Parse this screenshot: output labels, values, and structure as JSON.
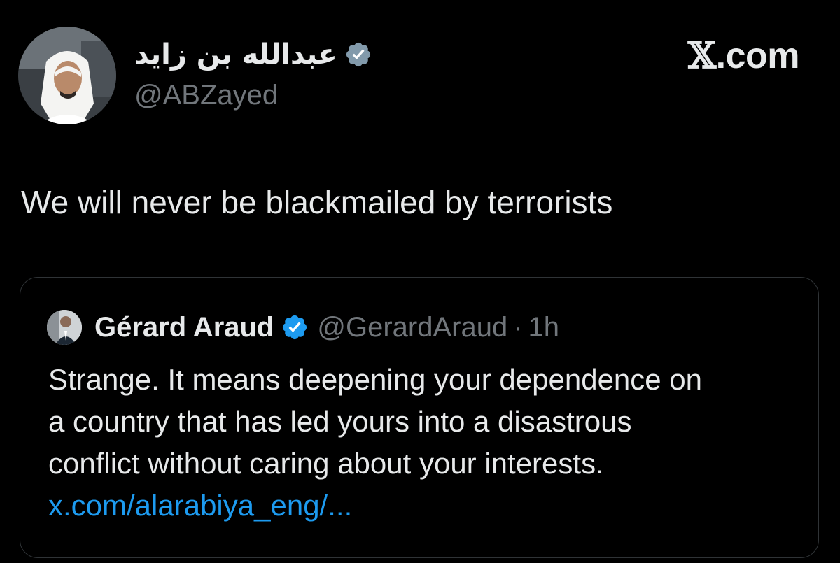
{
  "header": {
    "author_name": "عبدالله بن زايد",
    "author_handle": "@ABZayed",
    "brand": {
      "x_mark": "𝕏",
      "suffix": ".com"
    }
  },
  "tweet": {
    "text": "We will never be blackmailed by terrorists"
  },
  "quoted_tweet": {
    "author_name": "Gérard Araud",
    "author_handle": "@GerardAraud",
    "separator": "·",
    "time": "1h",
    "body_lines": [
      "Strange. It means deepening your dependence on",
      "a country that has led yours into a disastrous",
      "conflict without caring about your interests."
    ],
    "link": "x.com/alarabiya_eng/..."
  },
  "colors": {
    "background": "#000000",
    "primary_text": "#e7e9ea",
    "secondary_text": "#71767b",
    "link": "#1d9bf0",
    "verified_badge_main": "#829aab",
    "verified_badge_quote": "#1d9bf0",
    "quote_border": "#2f3336"
  },
  "icons": {
    "main_verified": "verified-badge-icon",
    "quote_verified": "verified-badge-icon"
  }
}
